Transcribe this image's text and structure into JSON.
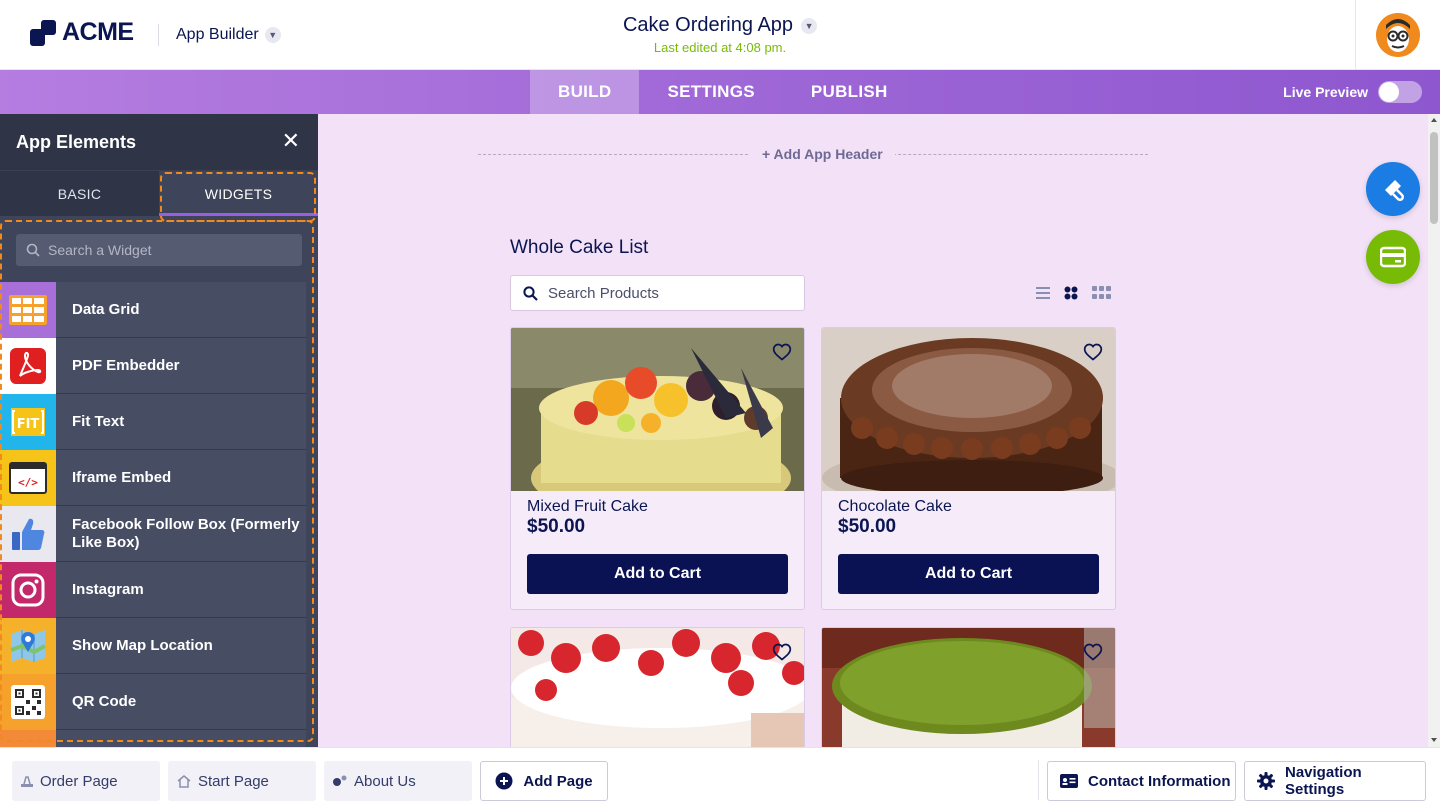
{
  "header": {
    "logo_text": "ACME",
    "app_builder_label": "App Builder",
    "app_title": "Cake Ordering App",
    "last_edited": "Last edited at 4:08 pm."
  },
  "nav": {
    "tabs": [
      {
        "label": "BUILD",
        "active": true
      },
      {
        "label": "SETTINGS",
        "active": false
      },
      {
        "label": "PUBLISH",
        "active": false
      }
    ],
    "live_preview_label": "Live Preview",
    "live_preview_on": false
  },
  "sidebar": {
    "title": "App Elements",
    "tabs": [
      {
        "label": "BASIC",
        "active": false
      },
      {
        "label": "WIDGETS",
        "active": true
      }
    ],
    "search_placeholder": "Search a Widget",
    "widgets": [
      {
        "label": "Data Grid",
        "icon": "data-grid-icon"
      },
      {
        "label": "PDF Embedder",
        "icon": "pdf-icon"
      },
      {
        "label": "Fit Text",
        "icon": "fit-text-icon"
      },
      {
        "label": "Iframe Embed",
        "icon": "code-icon"
      },
      {
        "label": "Facebook Follow Box (Formerly Like Box)",
        "icon": "thumbs-up-icon"
      },
      {
        "label": "Instagram",
        "icon": "instagram-icon"
      },
      {
        "label": "Show Map Location",
        "icon": "map-icon"
      },
      {
        "label": "QR Code",
        "icon": "qr-code-icon"
      }
    ]
  },
  "canvas": {
    "add_header_label": "+ Add App Header",
    "list_title": "Whole Cake List",
    "search_placeholder": "Search Products",
    "products": [
      {
        "name": "Mixed Fruit Cake",
        "price": "$50.00",
        "button": "Add to Cart"
      },
      {
        "name": "Chocolate Cake",
        "price": "$50.00",
        "button": "Add to Cart"
      },
      {
        "name": "",
        "price": "",
        "button": ""
      },
      {
        "name": "",
        "price": "",
        "button": ""
      }
    ]
  },
  "bottom": {
    "pages": [
      {
        "label": "Order Page",
        "icon": "order-icon"
      },
      {
        "label": "Start Page",
        "icon": "home-icon"
      },
      {
        "label": "About Us",
        "icon": "about-icon"
      }
    ],
    "add_page_label": "Add Page",
    "contact_label": "Contact Information",
    "nav_settings_label": "Navigation Settings"
  },
  "colors": {
    "brand_navy": "#0a1551",
    "nav_purple": "#9d66d6",
    "accent_orange": "#f08a1d",
    "edited_green": "#78bb07",
    "canvas_bg": "#f3e1f7"
  }
}
